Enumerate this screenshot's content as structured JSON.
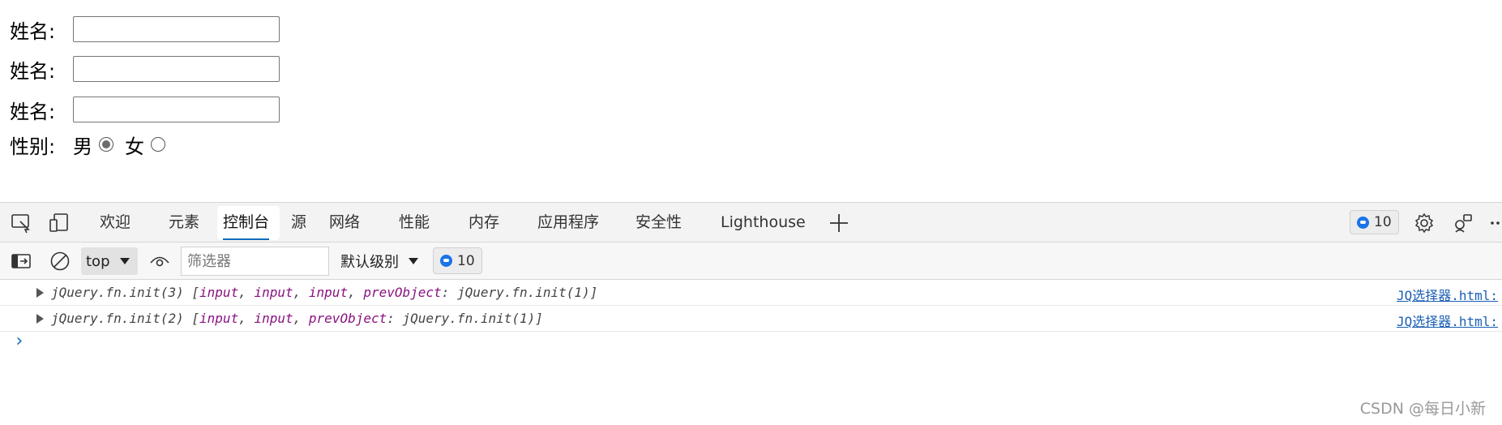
{
  "form": {
    "name_label": "姓名:",
    "name_values": [
      "",
      "",
      ""
    ],
    "gender_label": "性别:",
    "male_label": "男",
    "female_label": "女",
    "male_checked": true,
    "female_checked": false
  },
  "devtools": {
    "tabs": [
      "欢迎",
      "元素",
      "控制台",
      "源",
      "网络",
      "性能",
      "内存",
      "应用程序",
      "安全性",
      "Lighthouse"
    ],
    "active_tab": "控制台",
    "message_count": "10",
    "console_toolbar": {
      "context": "top",
      "filter_placeholder": "筛选器",
      "level": "默认级别",
      "message_count": "10"
    },
    "logs": [
      {
        "prefix": "jQuery.fn.init(3) [",
        "items": [
          "input",
          "input",
          "input"
        ],
        "prevobject_key": "prevObject",
        "prevobject_val": "jQuery.fn.init(1)]",
        "source": "JQ选择器.html:"
      },
      {
        "prefix": "jQuery.fn.init(2) [",
        "items": [
          "input",
          "input"
        ],
        "prevobject_key": "prevObject",
        "prevobject_val": "jQuery.fn.init(1)]",
        "source": "JQ选择器.html:"
      }
    ],
    "prompt": "›"
  },
  "watermark": "CSDN @每日小新",
  "colors": {
    "accent": "#0f6cbd",
    "badge_dot": "#1a73e8",
    "keyword": "#881280"
  }
}
